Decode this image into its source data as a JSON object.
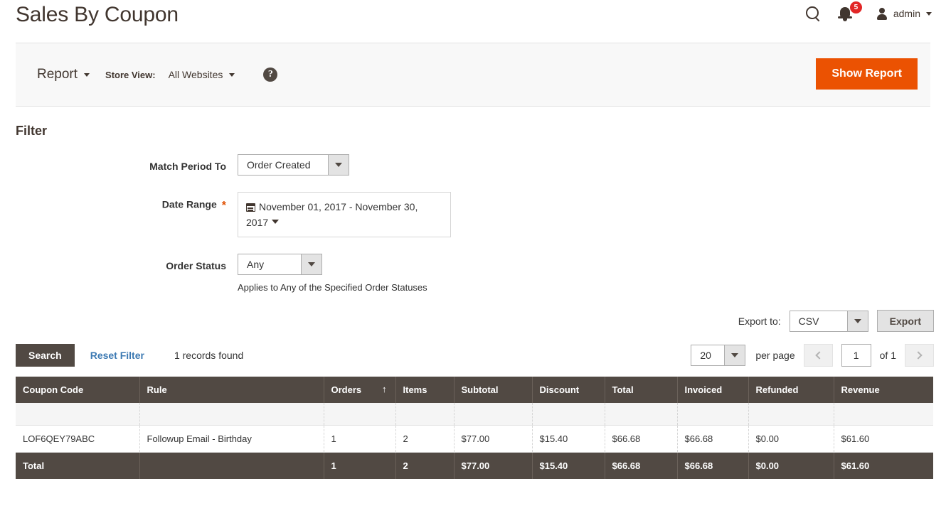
{
  "header": {
    "title": "Sales By Coupon",
    "search_icon": "search-icon",
    "notification_count": "5",
    "admin_label": "admin"
  },
  "toolbar": {
    "report_label": "Report",
    "store_view_label": "Store View:",
    "store_view_value": "All Websites",
    "help_glyph": "?",
    "show_report_label": "Show Report"
  },
  "filter": {
    "heading": "Filter",
    "match_period_label": "Match Period To",
    "match_period_value": "Order Created",
    "date_range_label": "Date Range",
    "date_range_required": "*",
    "date_range_value": "November 01, 2017 - November 30, 2017",
    "order_status_label": "Order Status",
    "order_status_value": "Any",
    "order_status_note": "Applies to Any of the Specified Order Statuses"
  },
  "export": {
    "label": "Export to:",
    "format": "CSV",
    "button": "Export"
  },
  "grid_controls": {
    "search_label": "Search",
    "reset_label": "Reset Filter",
    "records_found": "1 records found",
    "per_page_value": "20",
    "per_page_label": "per page",
    "current_page": "1",
    "of_label": "of 1"
  },
  "grid": {
    "columns": [
      {
        "label": "Coupon Code",
        "sort": ""
      },
      {
        "label": "Rule",
        "sort": ""
      },
      {
        "label": "Orders",
        "sort": "↑"
      },
      {
        "label": "Items",
        "sort": ""
      },
      {
        "label": "Subtotal",
        "sort": ""
      },
      {
        "label": "Discount",
        "sort": ""
      },
      {
        "label": "Total",
        "sort": ""
      },
      {
        "label": "Invoiced",
        "sort": ""
      },
      {
        "label": "Refunded",
        "sort": ""
      },
      {
        "label": "Revenue",
        "sort": ""
      }
    ],
    "rows": [
      {
        "coupon_code": "LOF6QEY79ABC",
        "rule": "Followup Email - Birthday",
        "orders": "1",
        "items": "2",
        "subtotal": "$77.00",
        "discount": "$15.40",
        "total": "$66.68",
        "invoiced": "$66.68",
        "refunded": "$0.00",
        "revenue": "$61.60"
      }
    ],
    "total_row": {
      "label": "Total",
      "rule": "",
      "orders": "1",
      "items": "2",
      "subtotal": "$77.00",
      "discount": "$15.40",
      "total": "$66.68",
      "invoiced": "$66.68",
      "refunded": "$0.00",
      "revenue": "$61.60"
    }
  },
  "colors": {
    "accent_orange": "#eb5202",
    "dark_brown": "#514943",
    "link_blue": "#3d7ab3",
    "badge_red": "#e22626"
  }
}
